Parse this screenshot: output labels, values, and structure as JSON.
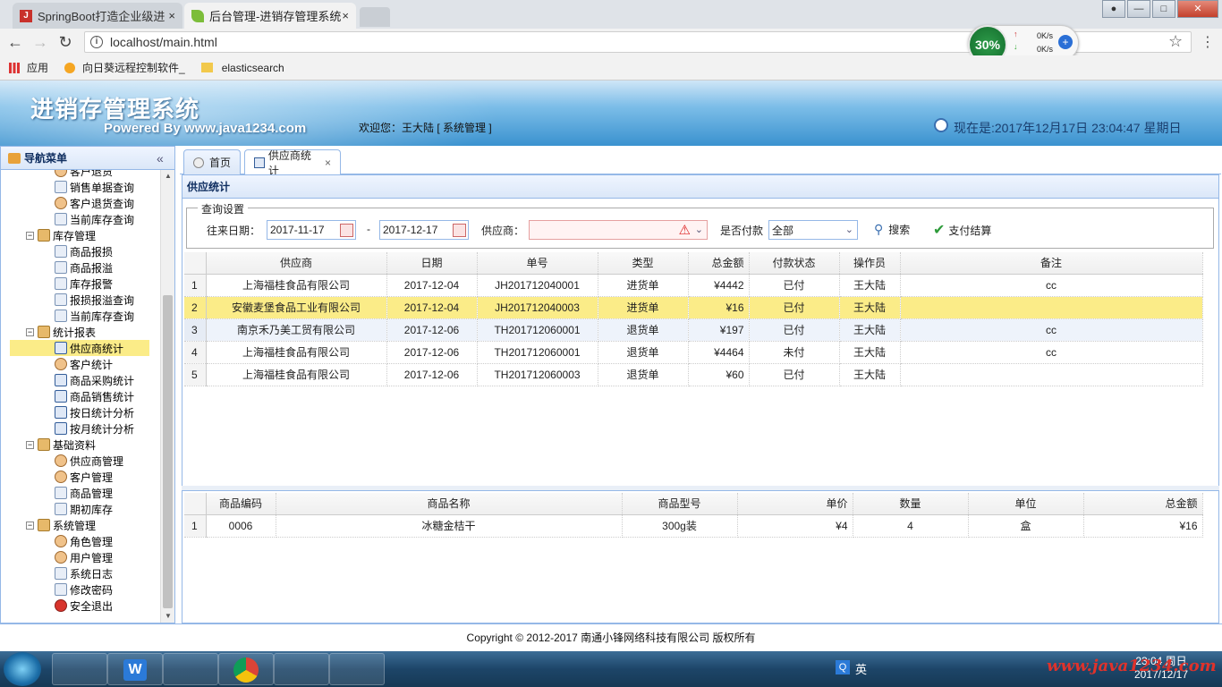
{
  "browser": {
    "tabs": [
      {
        "label": "SpringBoot打造企业级进",
        "close": "×"
      },
      {
        "label": "后台管理-进销存管理系统",
        "close": "×"
      }
    ],
    "url": "localhost/main.html",
    "bookmarks": [
      "应用",
      "向日葵远程控制软件_",
      "elasticsearch"
    ],
    "netmon": {
      "percent": "30%",
      "up": "0K/s",
      "down": "0K/s"
    }
  },
  "header": {
    "logo_title": "进销存管理系统",
    "logo_sub": "Powered By www.java1234.com",
    "welcome": "欢迎您：王大陆 [ 系统管理 ]",
    "datetime": "现在是:2017年12月17日 23:04:47 星期日"
  },
  "nav": {
    "title": "导航菜单",
    "items": [
      {
        "label": "客户退货",
        "level": 2
      },
      {
        "label": "销售单据查询",
        "level": 2
      },
      {
        "label": "客户退货查询",
        "level": 2
      },
      {
        "label": "当前库存查询",
        "level": 2
      },
      {
        "label": "库存管理",
        "level": 1
      },
      {
        "label": "商品报损",
        "level": 2
      },
      {
        "label": "商品报溢",
        "level": 2
      },
      {
        "label": "库存报警",
        "level": 2
      },
      {
        "label": "报损报溢查询",
        "level": 2
      },
      {
        "label": "当前库存查询",
        "level": 2
      },
      {
        "label": "统计报表",
        "level": 1
      },
      {
        "label": "供应商统计",
        "level": 2,
        "selected": true
      },
      {
        "label": "客户统计",
        "level": 2
      },
      {
        "label": "商品采购统计",
        "level": 2
      },
      {
        "label": "商品销售统计",
        "level": 2
      },
      {
        "label": "按日统计分析",
        "level": 2
      },
      {
        "label": "按月统计分析",
        "level": 2
      },
      {
        "label": "基础资料",
        "level": 1
      },
      {
        "label": "供应商管理",
        "level": 2
      },
      {
        "label": "客户管理",
        "level": 2
      },
      {
        "label": "商品管理",
        "level": 2
      },
      {
        "label": "期初库存",
        "level": 2
      },
      {
        "label": "系统管理",
        "level": 1
      },
      {
        "label": "角色管理",
        "level": 2
      },
      {
        "label": "用户管理",
        "level": 2
      },
      {
        "label": "系统日志",
        "level": 2
      },
      {
        "label": "修改密码",
        "level": 2
      },
      {
        "label": "安全退出",
        "level": 2
      }
    ]
  },
  "main_tabs": [
    {
      "label": "首页"
    },
    {
      "label": "供应商统计",
      "close": "×"
    }
  ],
  "panel": {
    "title": "供应统计",
    "legend": "查询设置",
    "date_label": "往来日期：",
    "date_from": "2017-11-17",
    "date_sep": "-",
    "date_to": "2017-12-17",
    "supplier_label": "供应商：",
    "supplier_value": "",
    "paid_label": "是否付款",
    "paid_value": "全部",
    "search_btn": "搜索",
    "pay_btn": "支付结算"
  },
  "grid1": {
    "headers": [
      "",
      "供应商",
      "日期",
      "单号",
      "类型",
      "总金额",
      "付款状态",
      "操作员",
      "备注"
    ],
    "rows": [
      [
        "1",
        "上海福桂食品有限公司",
        "2017-12-04",
        "JH201712040001",
        "进货单",
        "¥4442",
        "已付",
        "王大陆",
        "cc"
      ],
      [
        "2",
        "安徽麦堡食品工业有限公司",
        "2017-12-04",
        "JH201712040003",
        "进货单",
        "¥16",
        "已付",
        "王大陆",
        ""
      ],
      [
        "3",
        "南京禾乃美工贸有限公司",
        "2017-12-06",
        "TH201712060001",
        "退货单",
        "¥197",
        "已付",
        "王大陆",
        "cc"
      ],
      [
        "4",
        "上海福桂食品有限公司",
        "2017-12-06",
        "TH201712060001",
        "退货单",
        "¥4464",
        "未付",
        "王大陆",
        "cc"
      ],
      [
        "5",
        "上海福桂食品有限公司",
        "2017-12-06",
        "TH201712060003",
        "退货单",
        "¥60",
        "已付",
        "王大陆",
        ""
      ]
    ]
  },
  "grid2": {
    "headers": [
      "",
      "商品编码",
      "商品名称",
      "商品型号",
      "单价",
      "数量",
      "单位",
      "总金额"
    ],
    "rows": [
      [
        "1",
        "0006",
        "冰糖金桔干",
        "300g装",
        "¥4",
        "4",
        "盒",
        "¥16"
      ]
    ]
  },
  "footer": {
    "text": "Copyright © 2012-2017 南通小锋网络科技有限公司 版权所有"
  },
  "taskbar": {
    "clock_time": "23:04 周日",
    "clock_date": "2017/12/17",
    "ime": "英",
    "watermark": "www.java1234.com"
  }
}
